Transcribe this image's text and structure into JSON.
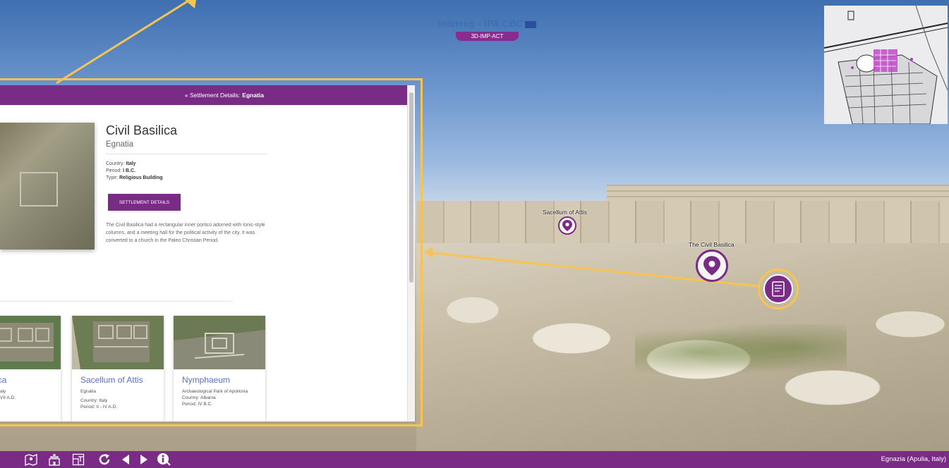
{
  "panel": {
    "breadcrumb_prefix": "« Settlement Details:",
    "breadcrumb_name": "Egnatia",
    "title": "Civil Basilica",
    "subtitle": "Egnatia",
    "country_label": "Country:",
    "country": "Italy",
    "period_label": "Period:",
    "period": "I B.C.",
    "type_label": "Type:",
    "type": "Religious Building",
    "button_label": "SETTLEMENT DETAILS",
    "description": "The Civil Basilica had a rectangular inner portico adorned with Ionic-style columns, and a meeting hall for the political activity of the city. It was converted to a church in the Paleo Christian Period."
  },
  "cards": [
    {
      "title": "Basilica",
      "line1": "",
      "line2": "aly",
      "line3": "VII A.D."
    },
    {
      "title": "Sacellum of Attis",
      "line1": "Egnatia",
      "line2": "Country: Italy",
      "line3": "Period: II - IV A.D."
    },
    {
      "title": "Nymphaeum",
      "line1": "Archaeological Park of Apollonia",
      "line2": "Country: Albania",
      "line3": "Period: IV B.C."
    }
  ],
  "hotspots": {
    "sacellum": "Sacellum of Attis",
    "basilica": "The Civil Basilica"
  },
  "logo": {
    "program": "Interreg - IPA CBC",
    "project": "3D-IMP-ACT"
  },
  "footer": {
    "location": "Egnazia (Apulia, Italy)"
  },
  "colors": {
    "brand": "#7a2b86",
    "annotation": "#f6c453",
    "card_title": "#5b6fc2"
  },
  "icons": [
    "map-pin-icon",
    "castle-icon",
    "floorplan-icon",
    "rotate-icon",
    "arrow-left-icon",
    "arrow-right-icon",
    "info-icon",
    "document-icon"
  ]
}
